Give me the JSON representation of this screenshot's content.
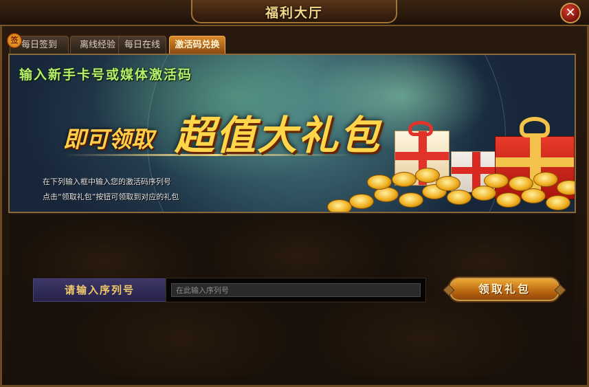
{
  "window": {
    "title": "福利大厅",
    "close_symbol": "✕"
  },
  "tabs": [
    {
      "label": "每日签到",
      "active": false,
      "badge": "签"
    },
    {
      "label": "离线经验",
      "active": false
    },
    {
      "label": "每日在线",
      "active": false
    },
    {
      "label": "激活码兑换",
      "active": true
    }
  ],
  "banner": {
    "headline": "输入新手卡号或媒体激活码",
    "slogan_small": "即可领取",
    "slogan_big": "超值大礼包",
    "instructions": [
      "在下列输入框中输入您的激活码序列号",
      "点击“领取礼包”按钮可领取到对应的礼包"
    ]
  },
  "redeem": {
    "label": "请输入序列号",
    "placeholder": "在此输入序列号",
    "value": "",
    "button_label": "领取礼包"
  },
  "colors": {
    "accent_gold": "#f5d889",
    "headline_green": "#b7f06a",
    "tab_active": "#d98a2a",
    "label_bg": "#3c3766"
  }
}
